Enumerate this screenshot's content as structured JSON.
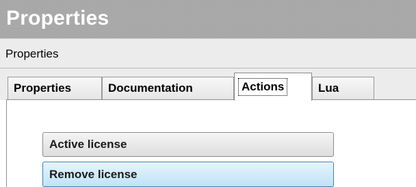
{
  "window": {
    "title": "Properties"
  },
  "subheader": {
    "label": "Properties"
  },
  "tabs": [
    {
      "label": "Properties",
      "active": false
    },
    {
      "label": "Documentation",
      "active": false
    },
    {
      "label": "Actions",
      "active": true
    },
    {
      "label": "Lua",
      "active": false
    }
  ],
  "actions": {
    "buttons": [
      {
        "label": "Active license",
        "state": "normal"
      },
      {
        "label": "Remove license",
        "state": "hover"
      }
    ]
  },
  "colors": {
    "titlebar": "#a9a9a9",
    "title_text": "#ffffff",
    "hover_border": "#3c7fb1",
    "hover_fill": "#bfe3f8"
  }
}
